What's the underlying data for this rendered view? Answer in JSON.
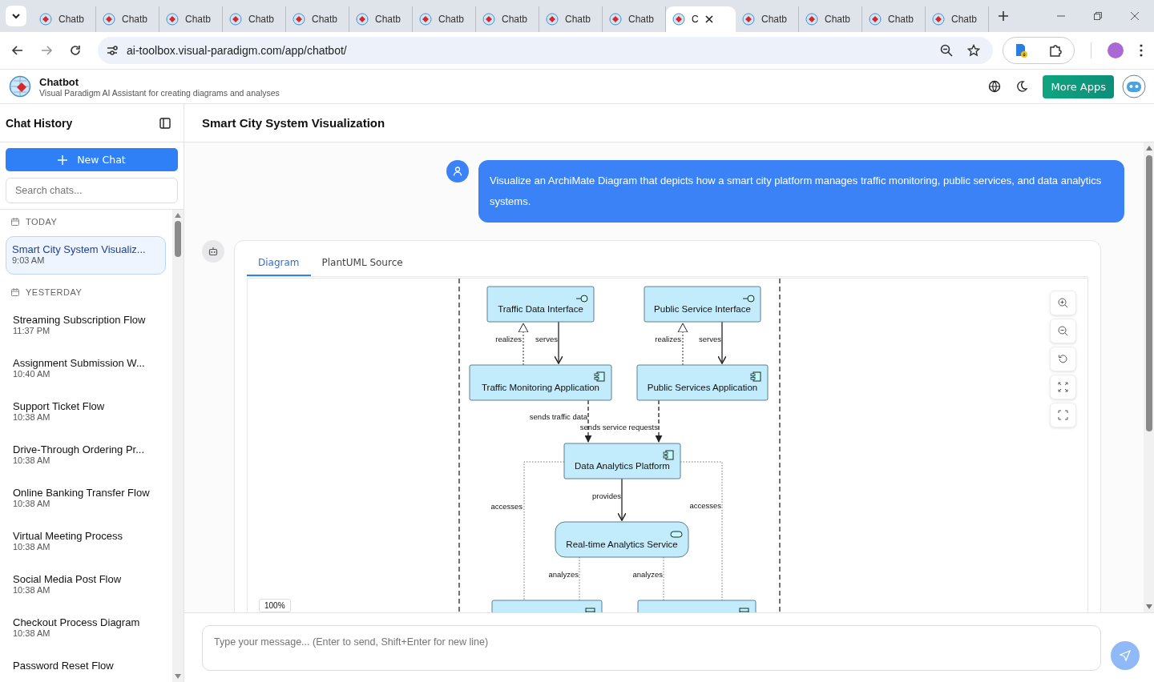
{
  "browser": {
    "tabs": [
      {
        "title": "Chatb",
        "selected": false
      },
      {
        "title": "Chatb",
        "selected": false
      },
      {
        "title": "Chatb",
        "selected": false
      },
      {
        "title": "Chatb",
        "selected": false
      },
      {
        "title": "Chatb",
        "selected": false
      },
      {
        "title": "Chatb",
        "selected": false
      },
      {
        "title": "Chatb",
        "selected": false
      },
      {
        "title": "Chatb",
        "selected": false
      },
      {
        "title": "Chatb",
        "selected": false
      },
      {
        "title": "Chatb",
        "selected": false
      },
      {
        "title": "C",
        "selected": true
      },
      {
        "title": "Chatb",
        "selected": false
      },
      {
        "title": "Chatb",
        "selected": false
      },
      {
        "title": "Chatb",
        "selected": false
      },
      {
        "title": "Chatb",
        "selected": false
      }
    ],
    "url": "ai-toolbox.visual-paradigm.com/app/chatbot/"
  },
  "app": {
    "title": "Chatbot",
    "subtitle": "Visual Paradigm AI Assistant for creating diagrams and analyses",
    "more_apps": "More Apps"
  },
  "sidebar": {
    "title": "Chat History",
    "new_chat": "New Chat",
    "search_placeholder": "Search chats...",
    "groups": [
      {
        "label": "TODAY",
        "items": [
          {
            "title": "Smart City System Visualiz...",
            "time": "9:03 AM",
            "selected": true
          }
        ]
      },
      {
        "label": "YESTERDAY",
        "items": [
          {
            "title": "Streaming Subscription Flow",
            "time": "11:37 PM",
            "selected": false
          },
          {
            "title": "Assignment Submission W...",
            "time": "10:40 AM",
            "selected": false
          },
          {
            "title": "Support Ticket Flow",
            "time": "10:38 AM",
            "selected": false
          },
          {
            "title": "Drive-Through Ordering Pr...",
            "time": "10:38 AM",
            "selected": false
          },
          {
            "title": "Online Banking Transfer Flow",
            "time": "10:38 AM",
            "selected": false
          },
          {
            "title": "Virtual Meeting Process",
            "time": "10:38 AM",
            "selected": false
          },
          {
            "title": "Social Media Post Flow",
            "time": "10:38 AM",
            "selected": false
          },
          {
            "title": "Checkout Process Diagram",
            "time": "10:38 AM",
            "selected": false
          },
          {
            "title": "Password Reset Flow",
            "selected": false
          }
        ]
      }
    ]
  },
  "chat": {
    "title": "Smart City System Visualization",
    "user_message": "Visualize an ArchiMate Diagram that depicts how a smart city platform manages traffic monitoring, public services, and data analytics systems.",
    "response": {
      "tabs": [
        {
          "label": "Diagram",
          "selected": true
        },
        {
          "label": "PlantUML Source",
          "selected": false
        }
      ],
      "zoom": "100%",
      "diagram": {
        "nodes": [
          {
            "kind": "interface",
            "label": "Traffic Data Interface"
          },
          {
            "kind": "interface",
            "label": "Public Service Interface"
          },
          {
            "kind": "application",
            "label": "Traffic Monitoring Application"
          },
          {
            "kind": "application",
            "label": "Public Services Application"
          },
          {
            "kind": "application",
            "label": "Data Analytics Platform"
          },
          {
            "kind": "service",
            "label": "Real-time Analytics Service"
          },
          {
            "kind": "data"
          },
          {
            "kind": "data"
          }
        ],
        "edges": [
          {
            "kind": "realization",
            "label": "realizes"
          },
          {
            "kind": "serving",
            "label": "serves"
          },
          {
            "kind": "realization",
            "label": "realizes"
          },
          {
            "kind": "serving",
            "label": "serves"
          },
          {
            "kind": "flow",
            "label": "sends traffic data"
          },
          {
            "kind": "flow",
            "label": "sends service requests"
          },
          {
            "kind": "access",
            "label": "accesses"
          },
          {
            "kind": "access",
            "label": "accesses"
          },
          {
            "kind": "serving",
            "label": "provides"
          },
          {
            "kind": "access",
            "label": "analyzes"
          },
          {
            "kind": "access",
            "label": "analyzes"
          }
        ]
      }
    }
  },
  "composer": {
    "placeholder": "Type your message... (Enter to send, Shift+Enter for new line)"
  }
}
